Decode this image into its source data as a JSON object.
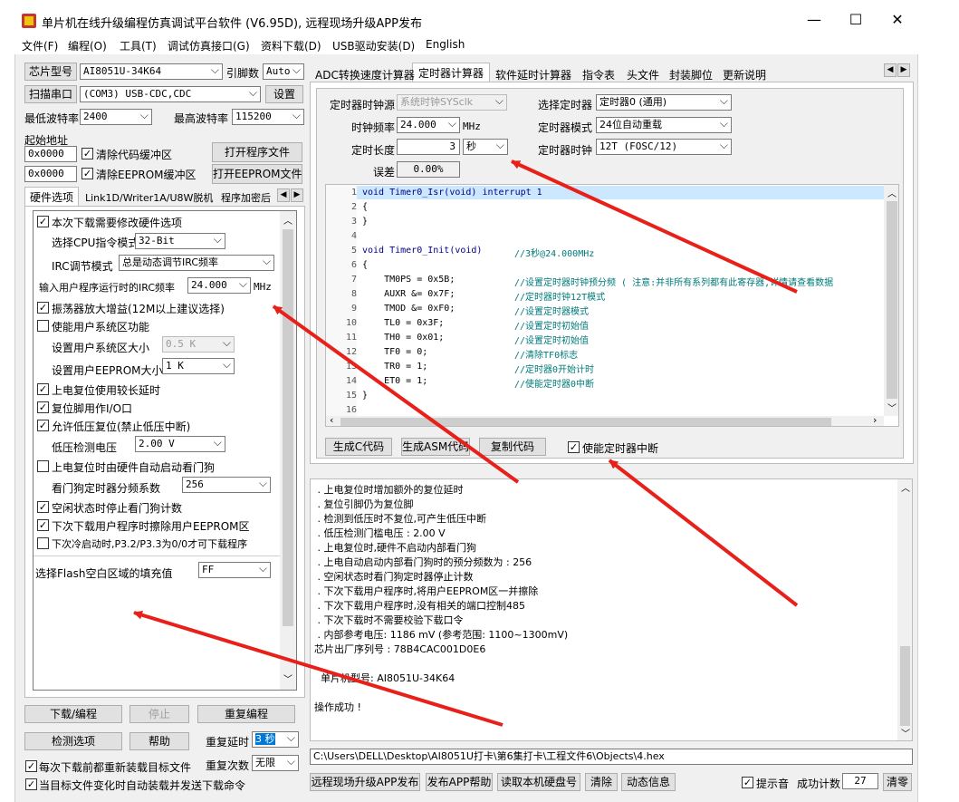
{
  "window": {
    "title": "单片机在线升级编程仿真调试平台软件 (V6.95D), 远程现场升级APP发布",
    "minimize": "—",
    "maximize": "☐",
    "close": "✕"
  },
  "menu": [
    "文件(F)",
    "编程(O)",
    "工具(T)",
    "调试仿真接口(G)",
    "资料下载(D)",
    "USB驱动安装(D)",
    "English"
  ],
  "left": {
    "chip_label": "芯片型号",
    "chip_value": "AI8051U-34K64",
    "pins_label": "引脚数",
    "pins_value": "Auto",
    "scan_label": "扫描串口",
    "port_value": "(COM3) USB-CDC,CDC",
    "settings_label": "设置",
    "min_baud_label": "最低波特率",
    "min_baud_value": "2400",
    "max_baud_label": "最高波特率",
    "max_baud_value": "115200",
    "start_addr_label": "起始地址",
    "addr1": "0x0000",
    "clear_code_label": "清除代码缓冲区",
    "open_prog_label": "打开程序文件",
    "addr2": "0x0000",
    "clear_eeprom_label": "清除EEPROM缓冲区",
    "open_eeprom_label": "打开EEPROM文件",
    "tabs": [
      "硬件选项",
      "Link1D/Writer1A/U8W脱机",
      "程序加密后"
    ],
    "hw": {
      "modify_hw": "本次下载需要修改硬件选项",
      "cpu_mode_label": "选择CPU指令模式",
      "cpu_mode_value": "32-Bit",
      "irc_mode_label": "IRC调节模式",
      "irc_mode_value": "总是动态调节IRC频率",
      "irc_freq_label": "输入用户程序运行时的IRC频率",
      "irc_freq_value": "24.000",
      "irc_freq_unit": "MHz",
      "osc_gain": "振荡器放大增益(12M以上建议选择)",
      "user_sys": "使能用户系统区功能",
      "user_sys_size_label": "设置用户系统区大小",
      "user_sys_size_value": "0.5 K",
      "user_eeprom_label": "设置用户EEPROM大小",
      "user_eeprom_value": "1  K",
      "long_delay": "上电复位使用较长延时",
      "reset_io": "复位脚用作I/O口",
      "lvr": "允许低压复位(禁止低压中断)",
      "lvd_label": "低压检测电压",
      "lvd_value": "2.00 V",
      "wdt_auto": "上电复位时由硬件自动启动看门狗",
      "wdt_div_label": "看门狗定时器分频系数",
      "wdt_div_value": "256",
      "idle_wdt": "空闲状态时停止看门狗计数",
      "erase_eeprom": "下次下载用户程序时擦除用户EEPROM区",
      "p32p33": "下次冷启动时,P3.2/P3.3为0/0才可下载程序",
      "flash_fill_label": "选择Flash空白区域的填充值",
      "flash_fill_value": "FF"
    },
    "download_label": "下载/编程",
    "stop_label": "停止",
    "reprogram_label": "重复编程",
    "check_label": "检测选项",
    "help_label": "帮助",
    "redelay_label": "重复延时",
    "redelay_value": "3 秒",
    "reload_each": "每次下载前都重新装载目标文件",
    "recount_label": "重复次数",
    "recount_value": "无限",
    "auto_send": "当目标文件变化时自动装载并发送下载命令"
  },
  "right": {
    "tabs": [
      "ADC转换速度计算器",
      "定时器计算器",
      "软件延时计算器",
      "指令表",
      "头文件",
      "封装脚位",
      "更新说明"
    ],
    "timer_src_label": "定时器时钟源",
    "timer_src_value": "系统时钟SYSclk",
    "select_timer_label": "选择定时器",
    "select_timer_value": "定时器0 (通用)",
    "clock_freq_label": "时钟频率",
    "clock_freq_value": "24.000",
    "clock_freq_unit": "MHz",
    "timer_mode_label": "定时器模式",
    "timer_mode_value": "24位自动重载",
    "timer_len_label": "定时长度",
    "timer_len_value": "3",
    "timer_len_unit": "秒",
    "timer_clk_label": "定时器时钟",
    "timer_clk_value": "12T (FOSC/12)",
    "error_label": "误差",
    "error_value": "0.00%",
    "code_lines": [
      {
        "n": "1",
        "code": "void Timer0_Isr(void) interrupt 1",
        "cm": ""
      },
      {
        "n": "2",
        "code": "{",
        "cm": ""
      },
      {
        "n": "3",
        "code": "}",
        "cm": ""
      },
      {
        "n": "4",
        "code": "",
        "cm": ""
      },
      {
        "n": "5",
        "code": "void Timer0_Init(void)",
        "cm": "//3秒@24.000MHz"
      },
      {
        "n": "6",
        "code": "{",
        "cm": ""
      },
      {
        "n": "7",
        "code": "    TM0PS = 0x5B;",
        "cm": "//设置定时器时钟预分频 ( 注意:并非所有系列都有此寄存器,详情请查看数据"
      },
      {
        "n": "8",
        "code": "    AUXR &= 0x7F;",
        "cm": "//定时器时钟12T模式"
      },
      {
        "n": "9",
        "code": "    TMOD &= 0xF0;",
        "cm": "//设置定时器模式"
      },
      {
        "n": "10",
        "code": "    TL0 = 0x3F;",
        "cm": "//设置定时初始值"
      },
      {
        "n": "11",
        "code": "    TH0 = 0x01;",
        "cm": "//设置定时初始值"
      },
      {
        "n": "12",
        "code": "    TF0 = 0;",
        "cm": "//清除TF0标志"
      },
      {
        "n": "13",
        "code": "    TR0 = 1;",
        "cm": "//定时器0开始计时"
      },
      {
        "n": "14",
        "code": "    ET0 = 1;",
        "cm": "//使能定时器0中断"
      },
      {
        "n": "15",
        "code": "}",
        "cm": ""
      },
      {
        "n": "16",
        "code": "",
        "cm": ""
      }
    ],
    "gen_c_label": "生成C代码",
    "gen_asm_label": "生成ASM代码",
    "copy_label": "复制代码",
    "enable_int_label": "使能定时器中断",
    "log": [
      " . 上电复位时增加额外的复位延时",
      " . 复位引脚仍为复位脚",
      " . 检测到低压时不复位,可产生低压中断",
      " . 低压检测门槛电压 : 2.00 V",
      " . 上电复位时,硬件不启动内部看门狗",
      " . 上电自动启动内部看门狗时的预分频数为 : 256",
      " . 空闲状态时看门狗定时器停止计数",
      " . 下次下载用户程序时,将用户EEPROM区一并擦除",
      " . 下次下载用户程序时,没有相关的端口控制485",
      " . 下次下载时不需要校验下载口令",
      " . 内部参考电压: 1186 mV (参考范围: 1100~1300mV)",
      "芯片出厂序列号 : 78B4CAC001D0E6",
      "",
      "  单片机型号: AI8051U-34K64",
      "",
      "操作成功 !"
    ],
    "path": "C:\\Users\\DELL\\Desktop\\AI8051U打卡\\第6集打卡\\工程文件6\\Objects\\4.hex",
    "bottom": {
      "remote_label": "远程现场升级APP发布",
      "publish_help_label": "发布APP帮助",
      "read_disk_label": "读取本机硬盘号",
      "clear_label": "清除",
      "dynamic_label": "动态信息",
      "beep_label": "提示音",
      "success_label": "成功计数",
      "success_value": "27",
      "reset_label": "清零"
    }
  },
  "colors": {
    "window_bg": "#f0f0f0",
    "highlight": "#cce8ff",
    "arrow": "#e8201a",
    "comment": "#007a7a",
    "keyword": "#00008b"
  }
}
